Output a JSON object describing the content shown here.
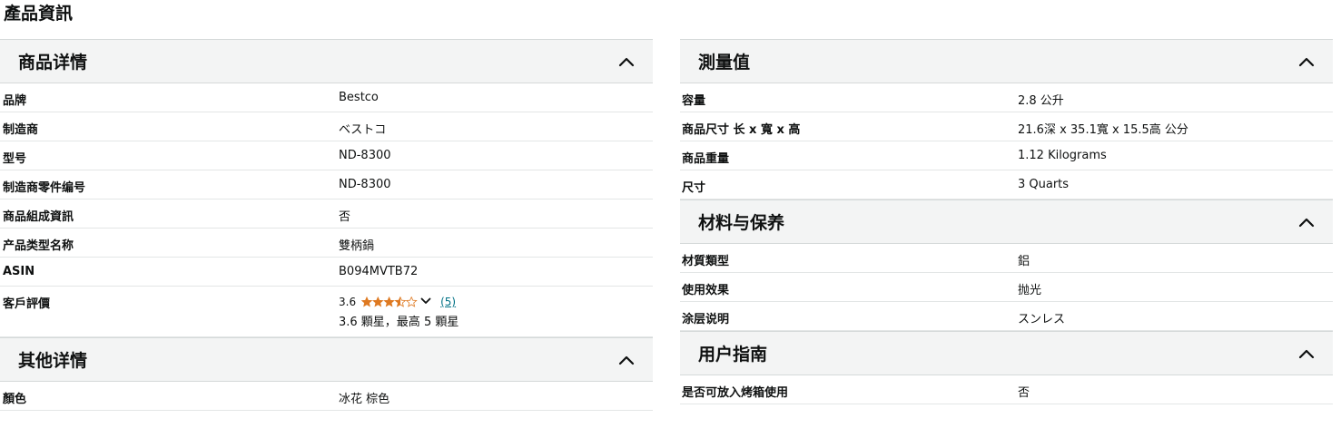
{
  "page_title": "產品資訊",
  "left": {
    "product_details": {
      "title": "商品详情",
      "rows": [
        {
          "k": "品牌",
          "v": "Bestco"
        },
        {
          "k": "制造商",
          "v": "ベストコ"
        },
        {
          "k": "型号",
          "v": "ND-8300"
        },
        {
          "k": "制造商零件编号",
          "v": "ND-8300"
        },
        {
          "k": "商品組成資訊",
          "v": "否"
        },
        {
          "k": "产品类型名称",
          "v": "雙柄鍋"
        },
        {
          "k": "ASIN",
          "v": "B094MVTB72"
        }
      ],
      "rating": {
        "label": "客戶評價",
        "value": "3.6",
        "stars": 3.6,
        "count_link": "(5)",
        "sub": "3.6 顆星，最高 5 顆星"
      }
    },
    "other_details": {
      "title": "其他详情",
      "rows": [
        {
          "k": "顏色",
          "v": "冰花 棕色"
        }
      ]
    }
  },
  "right": {
    "measurements": {
      "title": "測量值",
      "rows": [
        {
          "k": "容量",
          "v": "2.8 公升"
        },
        {
          "k": "商品尺寸 长 x 寬 x 高",
          "v": "21.6深 x 35.1寬 x 15.5高 公分"
        },
        {
          "k": "商品重量",
          "v": "1.12 Kilograms"
        },
        {
          "k": "尺寸",
          "v": "3 Quarts"
        }
      ]
    },
    "materials": {
      "title": "材料与保养",
      "rows": [
        {
          "k": "材質類型",
          "v": "鋁"
        },
        {
          "k": "使用效果",
          "v": "抛光"
        },
        {
          "k": "涂层说明",
          "v": "スンレス"
        }
      ]
    },
    "user_guide": {
      "title": "用户指南",
      "rows": [
        {
          "k": "是否可放入烤箱使用",
          "v": "否"
        }
      ]
    }
  },
  "colors": {
    "star": "#de7921",
    "link": "#007185",
    "header_bg": "#f3f4f4"
  }
}
